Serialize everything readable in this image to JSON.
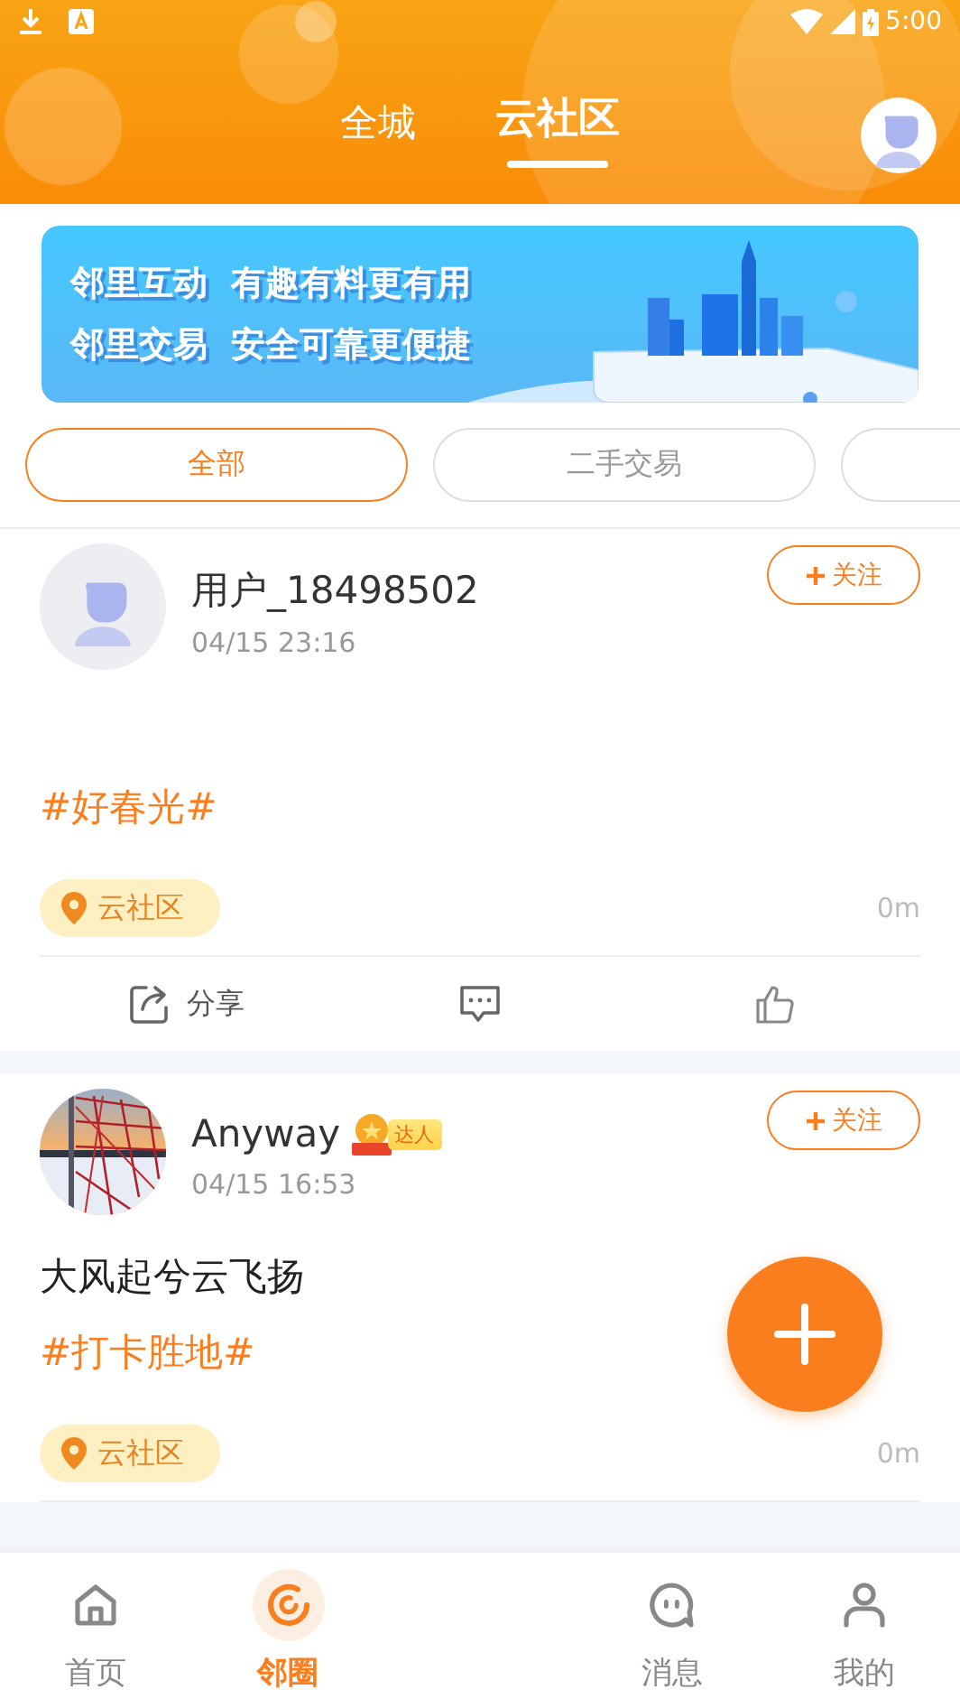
{
  "status_bar": {
    "time": "5:00"
  },
  "header": {
    "tabs": [
      {
        "label": "全城",
        "selected": false
      },
      {
        "label": "云社区",
        "selected": true
      }
    ]
  },
  "banner": {
    "lines": [
      "邻里互动  有趣有料更有用",
      "邻里交易  安全可靠更便捷"
    ]
  },
  "filters": [
    {
      "label": "全部",
      "selected": true
    },
    {
      "label": "二手交易",
      "selected": false
    }
  ],
  "posts": [
    {
      "photo_avatar": false,
      "name": "用户_18498502",
      "time": "04/15  23:16",
      "follow": "关注",
      "tag": "#好春光#",
      "location": "云社区",
      "distance": "0m",
      "actions": [
        {
          "kind": "share",
          "label": "分享"
        },
        {
          "kind": "comment"
        },
        {
          "kind": "like"
        }
      ]
    },
    {
      "photo_avatar": true,
      "name": "Anyway",
      "badge": "达人",
      "time": "04/15  16:53",
      "follow": "关注",
      "text": "大风起兮云飞扬",
      "tag": "#打卡胜地#",
      "location": "云社区",
      "distance": "0m"
    }
  ],
  "nav": [
    {
      "kind": "home",
      "label": "首页",
      "selected": false
    },
    {
      "kind": "circle",
      "label": "邻圈",
      "selected": true
    },
    {
      "kind": "message",
      "label": "消息",
      "selected": false
    },
    {
      "kind": "me",
      "label": "我的",
      "selected": false
    }
  ]
}
